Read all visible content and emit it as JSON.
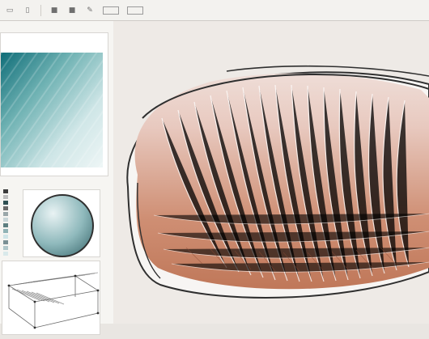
{
  "app": {
    "title": ""
  },
  "toolbar": {
    "items": [
      {
        "name": "toolbar-box-icon",
        "label": ""
      },
      {
        "name": "toolbar-pipe-icon",
        "label": ""
      },
      {
        "name": "toolbar-square-icon",
        "label": ""
      },
      {
        "name": "toolbar-square-icon-2",
        "label": ""
      },
      {
        "name": "toolbar-brush-icon",
        "label": ""
      },
      {
        "name": "toolbar-box-icon-2",
        "label": ""
      },
      {
        "name": "toolbar-box-icon-3",
        "label": ""
      }
    ]
  },
  "left_panel": {
    "swatches": [
      "#3c3c3c",
      "#bdbdbd",
      "#2e4f52",
      "#6a6a6a",
      "#9aa7a9",
      "#c9d6d8",
      "#5d7f80",
      "#90b3b6",
      "#cfe5e8",
      "#7a8f94",
      "#b0c7ca",
      "#d9e9ea"
    ]
  },
  "colors": {
    "accent": "#6fa3a2",
    "canvas": "#eeeae6",
    "panel": "#f6f5f2",
    "terra": "#b86c4c"
  }
}
